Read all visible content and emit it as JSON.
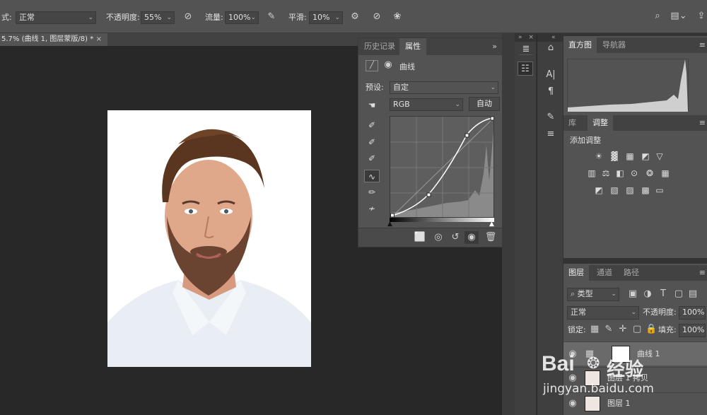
{
  "options_bar": {
    "mode_label": "式:",
    "mode_value": "正常",
    "opacity_label": "不透明度:",
    "opacity_value": "55%",
    "flow_label": "流量:",
    "flow_value": "100%",
    "smooth_label": "平滑:",
    "smooth_value": "10%"
  },
  "document_tab": {
    "title": "5.7% (曲线 1, 图层蒙版/8) *",
    "close": "×"
  },
  "properties_panel": {
    "tabs": [
      "历史记录",
      "属性"
    ],
    "header_title": "曲线",
    "preset_label": "预设:",
    "preset_value": "自定",
    "channel_value": "RGB",
    "auto_button": "自动",
    "collapse": "»",
    "menu": "≡"
  },
  "histogram_panel": {
    "tabs": [
      "直方图",
      "导航器"
    ],
    "menu": "≡"
  },
  "adjustments_panel": {
    "tabs": [
      "库",
      "调整"
    ],
    "add_label": "添加调整",
    "menu": "≡"
  },
  "layers_panel": {
    "tabs": [
      "图层",
      "通道",
      "路径"
    ],
    "filter_value": "类型",
    "blend_value": "正常",
    "opacity_label": "不透明度:",
    "opacity_value": "100%",
    "lock_label": "锁定:",
    "fill_label": "填充:",
    "fill_value": "100%",
    "layers": [
      {
        "name": "曲线 1"
      },
      {
        "name": "图层 1 拷贝"
      },
      {
        "name": "图层 1"
      }
    ],
    "menu": "≡"
  },
  "watermark": {
    "brand": "Bai",
    "brand2": "经验",
    "url": "jingyan.baidu.com"
  },
  "colors": {
    "accent": "#535353",
    "panel_dark": "#424242"
  }
}
